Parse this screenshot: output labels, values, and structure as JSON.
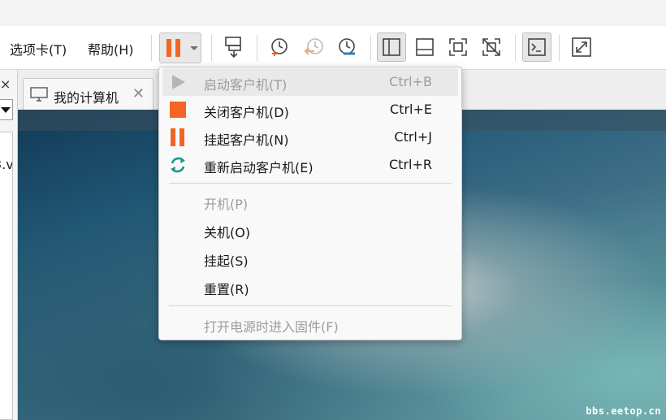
{
  "menubar": {
    "tabs_label": "选项卡(T)",
    "help_label": "帮助(H)"
  },
  "left_panel": {
    "close_glyph": "×",
    "list_fragment": "3.v"
  },
  "tab": {
    "label": "我的计算机",
    "close_glyph": "✕"
  },
  "watermark": "bbs.eetop.cn",
  "colors": {
    "accent_orange": "#f26522",
    "green": "#1a9a8a",
    "disabled": "#9c9c9c"
  },
  "power_menu": {
    "items": [
      {
        "label": "启动客户机(T)",
        "shortcut": "Ctrl+B",
        "icon": "play-icon",
        "disabled": true
      },
      {
        "label": "关闭客户机(D)",
        "shortcut": "Ctrl+E",
        "icon": "stop-icon",
        "disabled": false
      },
      {
        "label": "挂起客户机(N)",
        "shortcut": "Ctrl+J",
        "icon": "pause-icon",
        "disabled": false
      },
      {
        "label": "重新启动客户机(E)",
        "shortcut": "Ctrl+R",
        "icon": "restart-icon",
        "disabled": false
      },
      {
        "label": "开机(P)",
        "shortcut": "",
        "icon": "",
        "disabled": true
      },
      {
        "label": "关机(O)",
        "shortcut": "",
        "icon": "",
        "disabled": false
      },
      {
        "label": "挂起(S)",
        "shortcut": "",
        "icon": "",
        "disabled": false
      },
      {
        "label": "重置(R)",
        "shortcut": "",
        "icon": "",
        "disabled": false
      },
      {
        "label": "打开电源时进入固件(F)",
        "shortcut": "",
        "icon": "",
        "disabled": true
      }
    ]
  }
}
